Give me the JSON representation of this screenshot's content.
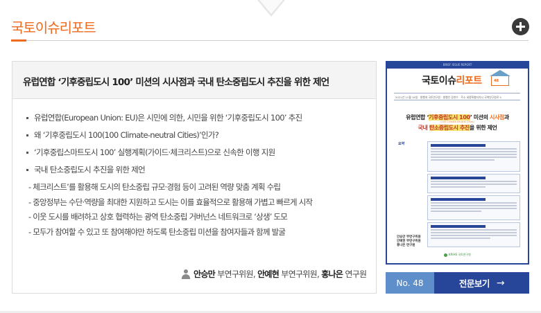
{
  "section": {
    "title": "국토이슈리포트",
    "more_label": "+"
  },
  "article": {
    "title": "유럽연합 ‘기후중립도시 100’ 미션의 시사점과 국내 탄소중립도시 추진을 위한 제언",
    "bullets": [
      "유럽연합(European Union: EU)은 시민에 의한, 시민을 위한 ‘기후중립도시 100’ 추진",
      "왜 ‘기후중립도시 100(100 Climate-neutral Cities)’인가?",
      "‘기후중립스마트도시 100’ 실행계획(가이드·체크리스트)으로 신속한 이행 지원",
      "국내 탄소중립도시 추진을 위한 제언"
    ],
    "sub_items": [
      "- 체크리스트’를 활용해 도시의 탄소중립 규모·경험 등이 고려된 역량 맞춤 계획 수립",
      "- 중앙정부는 수단·역량을 최대한 지원하고 도시는 이를 효율적으로 활용해 가볍고 빠르게 시작",
      "- 이웃 도시를 배려하고 상호 협력하는 광역 탄소중립 거버넌스 네트워크로 ‘상생’ 도모",
      "- 모두가 참여할 수 있고 또 참여해야만 하도록 탄소중립 미션을 참여자들과 함께 발굴"
    ],
    "authors": [
      {
        "name": "안승만",
        "role": "부연구위원"
      },
      {
        "name": "안예현",
        "role": "부연구위원"
      },
      {
        "name": "홍나은",
        "role": "연구원"
      }
    ]
  },
  "cover": {
    "top_caption": "BRIEF ISSUE REPORT",
    "logo_plain": "국토이슈",
    "logo_accent": "리포트",
    "issue_badge": "48",
    "meta_line": "2021년 11월 16일 · 발행처 국토연구원 · 발행인 강현수 · 주소 세종특별자치시 국책연구원로 5",
    "headline_pre": "유럽연합 ‘",
    "headline_highlight": "기후중립도시 100",
    "headline_post": "’ 미션의 ",
    "headline_accent": "시사점",
    "headline_end": "과",
    "headline_small": "(100 Climate-neutral Cities)",
    "headline2_pre": "국내 ",
    "headline2_highlight": "탄소중립도시 추진",
    "headline2_post": "을 위한 제언",
    "summary_label": "요약",
    "names": [
      "안승만 부연구위원",
      "안예현 부연구위원",
      "홍나은 연구원"
    ],
    "footer": "KRIHS 국토연구원"
  },
  "actions": {
    "issue_number": "No. 48",
    "view_label": "전문보기",
    "view_arrow": "→"
  },
  "colors": {
    "accent_orange": "#ee6a1c",
    "navy": "#27469a",
    "light_blue": "#5f8fcb"
  }
}
